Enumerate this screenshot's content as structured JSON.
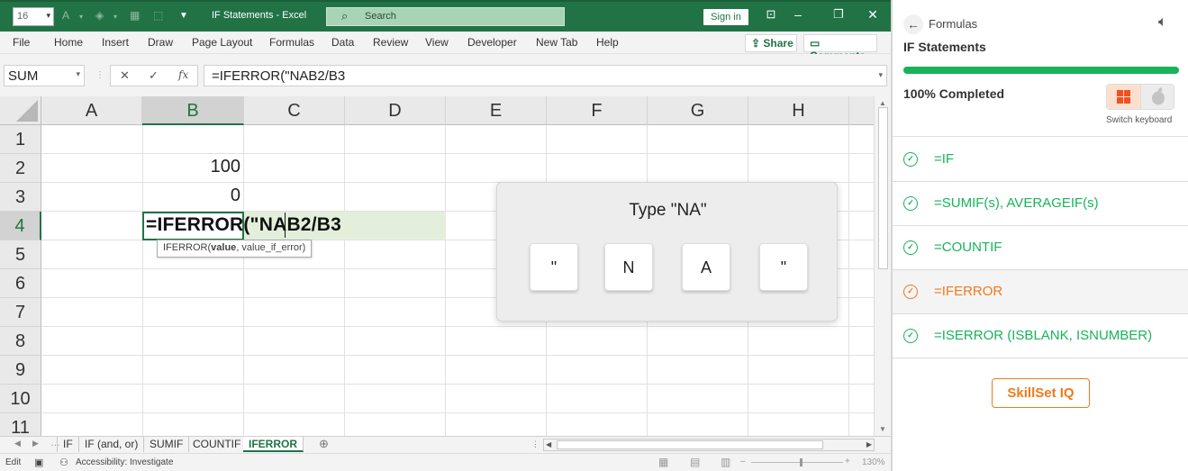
{
  "titlebar": {
    "font_size": "16",
    "doc_title": "IF Statements  -  Excel",
    "search_placeholder": "Search",
    "sign_in": "Sign in",
    "bg_color": "#217346"
  },
  "menu": {
    "items": [
      "File",
      "Home",
      "Insert",
      "Draw",
      "Page Layout",
      "Formulas",
      "Data",
      "Review",
      "View",
      "Developer",
      "New Tab",
      "Help"
    ],
    "share": "Share",
    "comments": "Comments"
  },
  "formula_bar": {
    "name_box": "SUM",
    "cancel": "✕",
    "enter": "✓",
    "fx": "fx",
    "formula": "=IFERROR(\"NAB2/B3"
  },
  "grid": {
    "columns": [
      "A",
      "B",
      "C",
      "D",
      "E",
      "F",
      "G",
      "H"
    ],
    "rows": [
      "1",
      "2",
      "3",
      "4",
      "5",
      "6",
      "7",
      "8",
      "9",
      "10",
      "11"
    ],
    "selected_column": "B",
    "selected_row": "4",
    "cells": {
      "B2": "100",
      "B3": "0"
    },
    "active_cell_text": "=IFERROR(\"NAB2/B3",
    "tooltip": {
      "fn": "IFERROR(",
      "bold_arg": "value",
      "rest": ", value_if_error)"
    }
  },
  "sheet_tabs": {
    "tabs": [
      "IF",
      "IF (and, or)",
      "SUMIF",
      "COUNTIF",
      "IFERROR"
    ],
    "active": "IFERROR"
  },
  "status_bar": {
    "mode": "Edit",
    "accessibility": "Accessibility: Investigate",
    "zoom": "130%"
  },
  "keyboard_popup": {
    "prompt": "Type \"NA\"",
    "keys": [
      "\"",
      "N",
      "A",
      "\""
    ]
  },
  "panel": {
    "breadcrumb": "Formulas",
    "title": "IF Statements",
    "progress_fraction": 1.0,
    "progress_text": "100% Completed",
    "switch_keyboard": "Switch keyboard",
    "lessons": [
      {
        "label": "=IF",
        "status": "done"
      },
      {
        "label": "=SUMIF(s), AVERAGEIF(s)",
        "status": "done"
      },
      {
        "label": "=COUNTIF",
        "status": "done"
      },
      {
        "label": "=IFERROR",
        "status": "current"
      },
      {
        "label": "=ISERROR (ISBLANK, ISNUMBER)",
        "status": "done"
      }
    ],
    "skillset_button": "SkillSet IQ",
    "accent_green": "#17b35a",
    "accent_orange": "#f07a1a"
  }
}
